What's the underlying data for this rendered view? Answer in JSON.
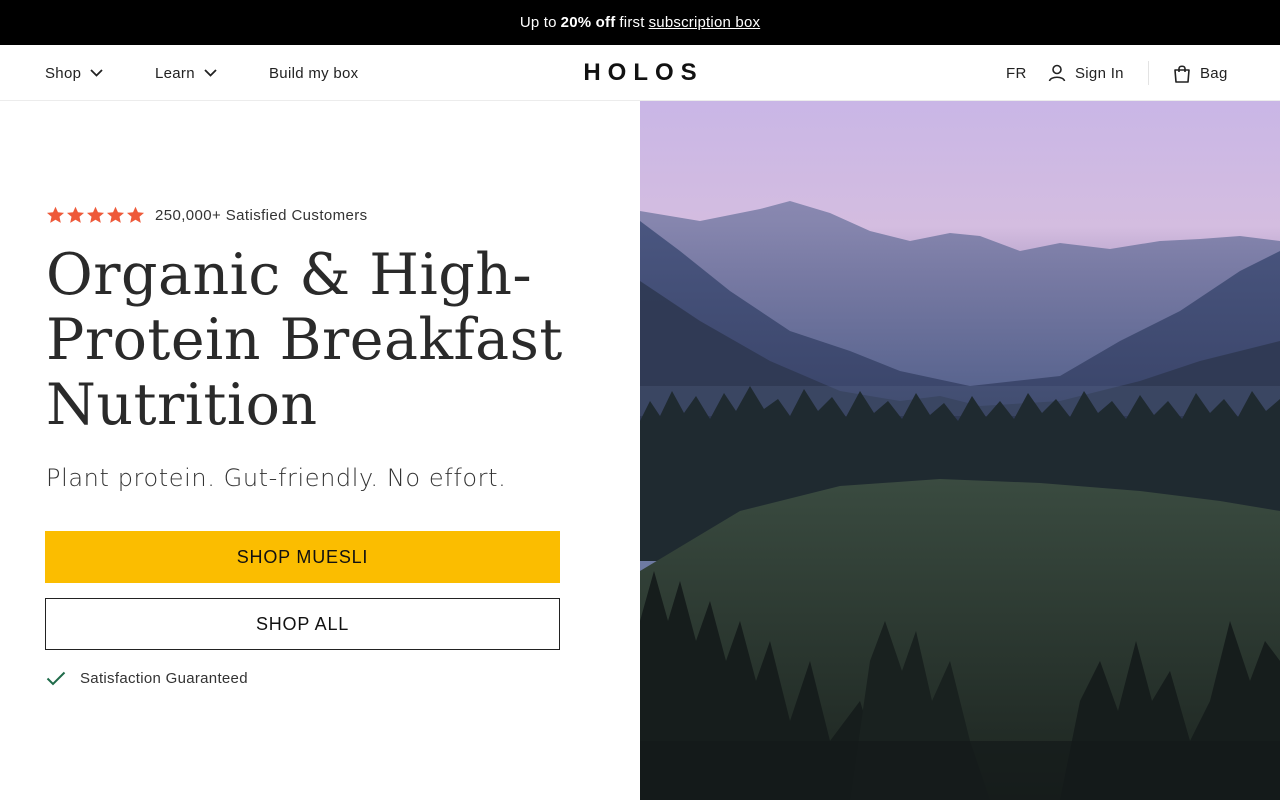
{
  "announcement": {
    "prefix": "Up to",
    "highlight": "20% off",
    "middle": "first",
    "link": "subscription box"
  },
  "nav": {
    "shop": "Shop",
    "learn": "Learn",
    "build": "Build my box",
    "logo": "HOLOS",
    "lang": "FR",
    "sign_in": "Sign In",
    "bag": "Bag"
  },
  "hero": {
    "rating_text": "250,000+ Satisfied Customers",
    "stars": 5,
    "headline_line1": "Organic & High-",
    "headline_line2": "Protein Breakfast",
    "headline_line3": "Nutrition",
    "subhead": "Plant protein. Gut-friendly. No effort.",
    "primary_cta": "SHOP MUESLI",
    "secondary_cta": "SHOP ALL",
    "guarantee": "Satisfaction Guaranteed"
  },
  "colors": {
    "star": "#ee5a3a",
    "primary_button": "#fbbd00",
    "check": "#1f6b4a",
    "announcement_bg": "#000000"
  },
  "icons": {
    "star": "star-icon",
    "chevron": "chevron-down-icon",
    "user": "user-icon",
    "bag": "shopping-bag-icon",
    "check": "check-icon"
  }
}
